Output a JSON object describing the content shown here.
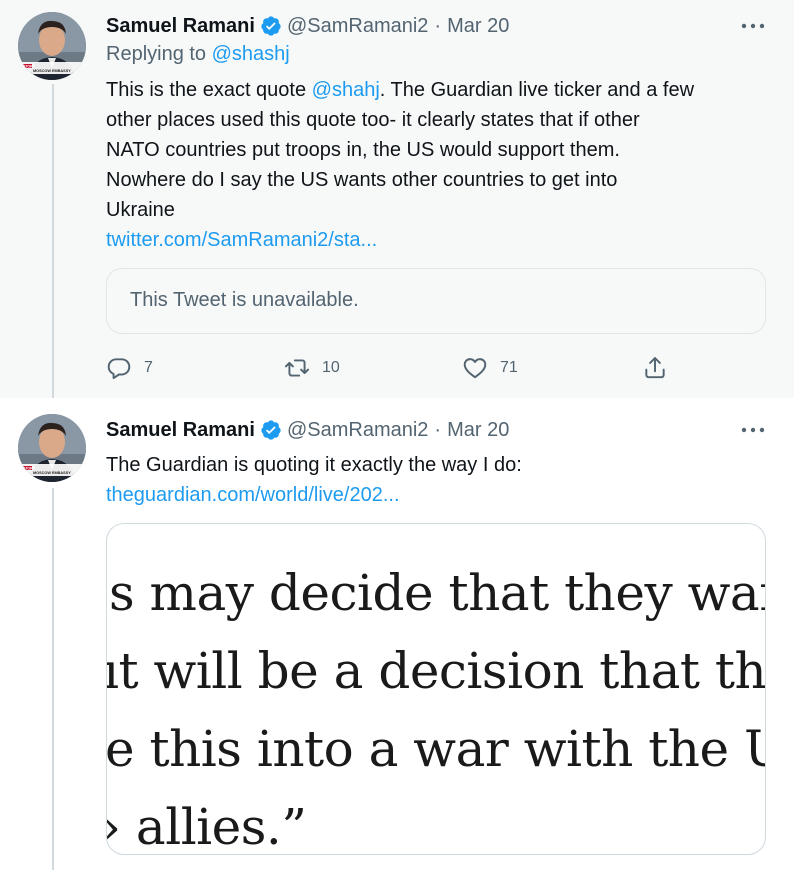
{
  "tweets": [
    {
      "author": "Samuel Ramani",
      "handle": "@SamRamani2",
      "separator": "·",
      "date": "Mar 20",
      "replying_prefix": "Replying to ",
      "replying_to": "@shashj",
      "body_lines": [
        "This is the exact quote @shahj. The Guardian live ticker and a few",
        "other places used this quote too- it clearly states that if other",
        "NATO countries put troops in, the US would support them.",
        "Nowhere do I say the US wants other countries to get into",
        "Ukraine"
      ],
      "mention_in_body": "@shahj",
      "link": "twitter.com/SamRamani2/sta...",
      "quoted_tweet": "This Tweet is unavailable.",
      "actions": {
        "reply_count": "7",
        "retweet_count": "10",
        "like_count": "71"
      }
    },
    {
      "author": "Samuel Ramani",
      "handle": "@SamRamani2",
      "separator": "·",
      "date": "Mar 20",
      "body_lines": [
        "The Guardian is quoting it exactly the way I do:"
      ],
      "link": "theguardian.com/world/live/202...",
      "media_lines": [
        "s may decide that they wan",
        "ıt will be a decision that the",
        "e this into a war with the Uı",
        "› allies.”"
      ]
    }
  ],
  "avatar_caption": {
    "tag": "STORY",
    "ticker": "MOSCOW EMBASSY"
  },
  "colors": {
    "link": "#1d9bf0",
    "muted": "#536471",
    "verified": "#1d9bf0",
    "highlight_bg": "#f7f9f9"
  }
}
